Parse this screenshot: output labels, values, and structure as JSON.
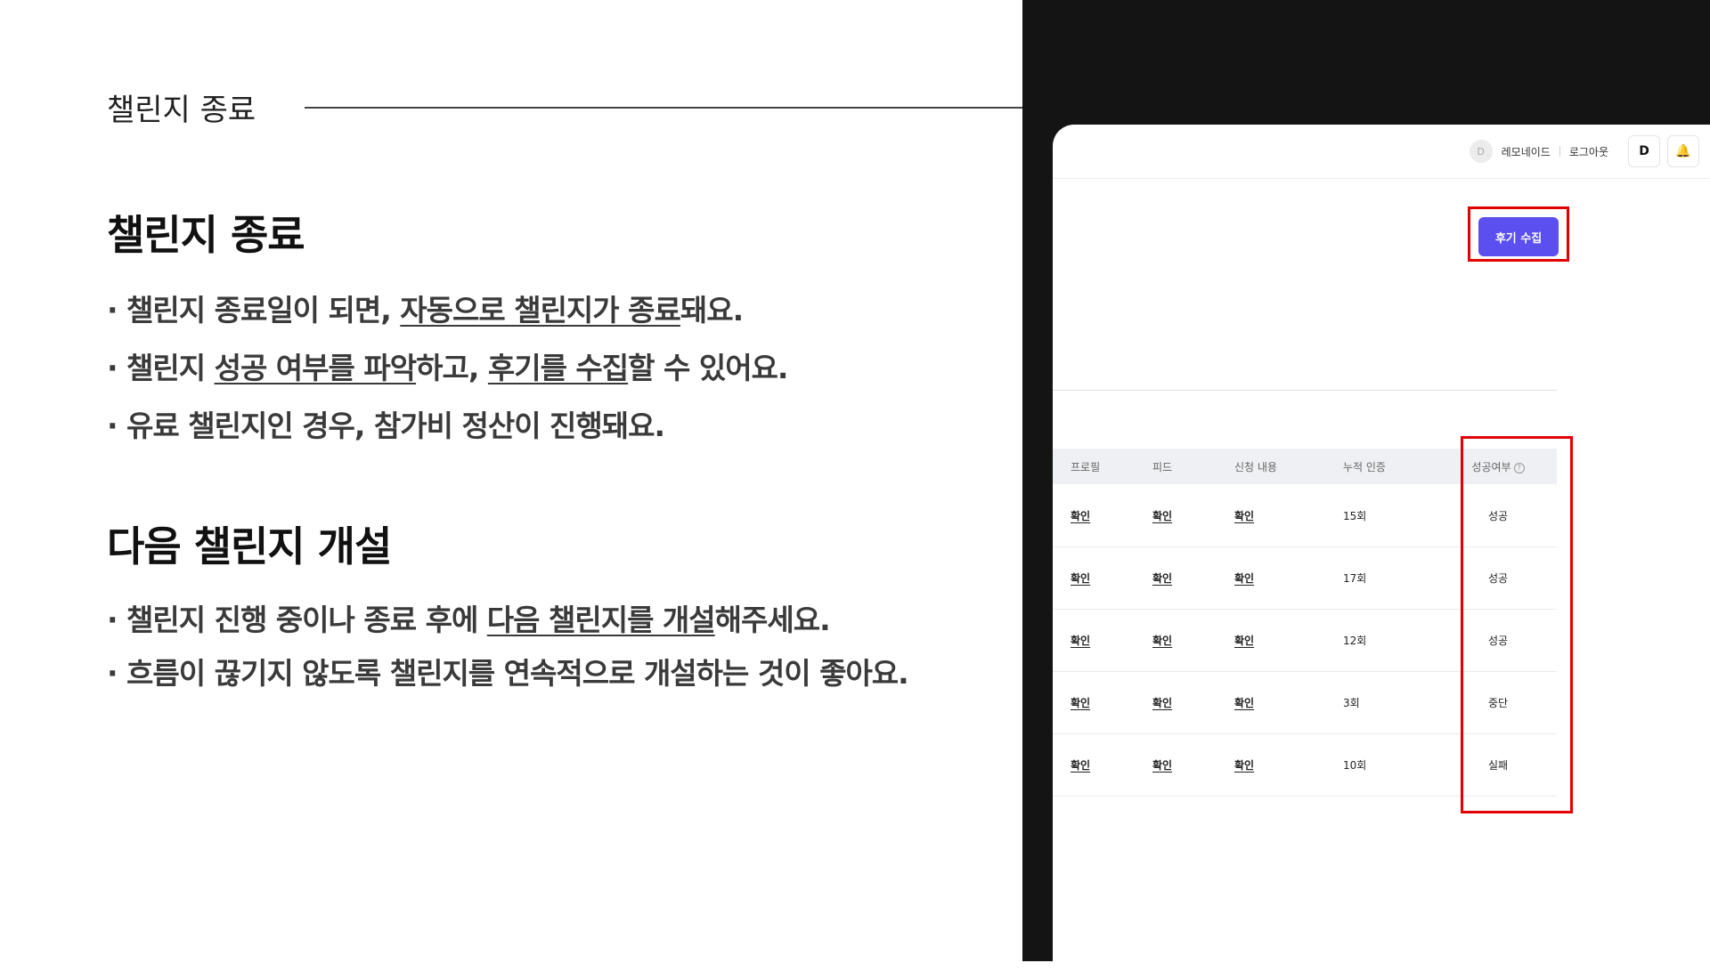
{
  "slide": {
    "section_label": "챌린지 종료",
    "block1": {
      "title": "챌린지 종료",
      "bullets": [
        {
          "a": "· 챌린지 종료일이 되면, ",
          "u": "자동으로 챌린지가 종료",
          "b": "돼요."
        },
        {
          "a": "· 챌린지 ",
          "u": "성공 여부를 파악",
          "b": "하고, ",
          "u2": "후기를 수집",
          "c": "할 수 있어요."
        },
        {
          "a": "· 유료 챌린지인 경우, 참가비 정산이 진행돼요."
        }
      ]
    },
    "block2": {
      "title": "다음 챌린지 개설",
      "bullets": [
        {
          "a": "· 챌린지 진행 중이나 종료 후에 ",
          "u": "다음 챌린지를 개설",
          "b": "해주세요."
        },
        {
          "a": "· 흐름이 끊기지 않도록 챌린지를 연속적으로 개설하는 것이 좋아요."
        }
      ]
    }
  },
  "app": {
    "topbar": {
      "avatar_glyph": "D",
      "user_name": "레모네이드",
      "logout_label": "로그아웃",
      "logo_glyph": "D",
      "bell_glyph": "🔔"
    },
    "review_button_label": "후기 수집",
    "table": {
      "headers": [
        "프로필",
        "피드",
        "신청 내용",
        "누적 인증",
        "성공여부"
      ],
      "help_glyph": "?",
      "rows": [
        {
          "profile": "확인",
          "feed": "확인",
          "application": "확인",
          "count": "15회",
          "status": "성공"
        },
        {
          "profile": "확인",
          "feed": "확인",
          "application": "확인",
          "count": "17회",
          "status": "성공"
        },
        {
          "profile": "확인",
          "feed": "확인",
          "application": "확인",
          "count": "12회",
          "status": "성공"
        },
        {
          "profile": "확인",
          "feed": "확인",
          "application": "확인",
          "count": "3회",
          "status": "중단"
        },
        {
          "profile": "확인",
          "feed": "확인",
          "application": "확인",
          "count": "10회",
          "status": "실패"
        }
      ]
    },
    "colors": {
      "accent": "#5b4ff0",
      "success": "#6b63d8",
      "fail": "#e03a3a",
      "highlight": "#e00000",
      "panel_bg": "#141414"
    }
  }
}
